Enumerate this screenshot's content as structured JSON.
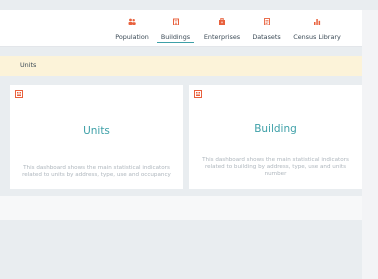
{
  "nav": {
    "items": [
      {
        "label": "Population",
        "icon": "people-icon",
        "active": false
      },
      {
        "label": "Buildings",
        "icon": "building-icon",
        "active": true
      },
      {
        "label": "Enterprises",
        "icon": "enterprise-icon",
        "active": false
      },
      {
        "label": "Datasets",
        "icon": "dataset-icon",
        "active": false
      },
      {
        "label": "Census Library",
        "icon": "chart-icon",
        "active": false
      }
    ]
  },
  "breadcrumb": {
    "label": "Units"
  },
  "cards": [
    {
      "title": "Units",
      "description": "This dashboard shows the main statistical indicators related to units by address, type, use and occupancy",
      "icon": "dashboard-icon"
    },
    {
      "title": "Building",
      "description": "This dashboard shows the main statistical indicators related to building by address, type, use and units number",
      "icon": "dashboard-icon"
    }
  ],
  "colors": {
    "accent": "#3ea0a8",
    "icon": "#e8603c",
    "breadcrumb_bg": "#fcf3d9",
    "page_bg": "#e9edf0"
  }
}
